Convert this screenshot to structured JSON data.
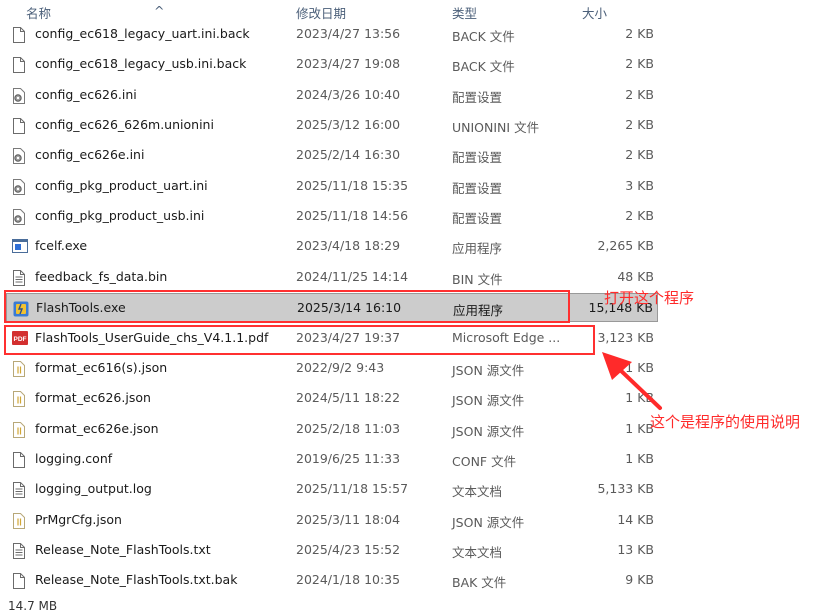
{
  "header": {
    "col_name": "名称",
    "col_date": "修改日期",
    "col_type": "类型",
    "col_size": "大小",
    "fragment": "^"
  },
  "files": [
    {
      "name": "config_ec618_legacy_uart.ini.back",
      "date": "2023/4/27 13:56",
      "type": "BACK 文件",
      "size": "2 KB",
      "icon": "blank-file-icon"
    },
    {
      "name": "config_ec618_legacy_usb.ini.back",
      "date": "2023/4/27 19:08",
      "type": "BACK 文件",
      "size": "2 KB",
      "icon": "blank-file-icon"
    },
    {
      "name": "config_ec626.ini",
      "date": "2024/3/26 10:40",
      "type": "配置设置",
      "size": "2 KB",
      "icon": "settings-file-icon"
    },
    {
      "name": "config_ec626_626m.unionini",
      "date": "2025/3/12 16:00",
      "type": "UNIONINI 文件",
      "size": "2 KB",
      "icon": "blank-file-icon"
    },
    {
      "name": "config_ec626e.ini",
      "date": "2025/2/14 16:30",
      "type": "配置设置",
      "size": "2 KB",
      "icon": "settings-file-icon"
    },
    {
      "name": "config_pkg_product_uart.ini",
      "date": "2025/11/18 15:35",
      "type": "配置设置",
      "size": "3 KB",
      "icon": "settings-file-icon"
    },
    {
      "name": "config_pkg_product_usb.ini",
      "date": "2025/11/18 14:56",
      "type": "配置设置",
      "size": "2 KB",
      "icon": "settings-file-icon"
    },
    {
      "name": "fcelf.exe",
      "date": "2023/4/18 18:29",
      "type": "应用程序",
      "size": "2,265 KB",
      "icon": "exe-icon"
    },
    {
      "name": "feedback_fs_data.bin",
      "date": "2024/11/25 14:14",
      "type": "BIN 文件",
      "size": "48 KB",
      "icon": "text-file-icon"
    },
    {
      "name": "FlashTools.exe",
      "date": "2025/3/14 16:10",
      "type": "应用程序",
      "size": "15,148 KB",
      "icon": "flashtools-app-icon",
      "selected": true
    },
    {
      "name": "FlashTools_UserGuide_chs_V4.1.1.pdf",
      "date": "2023/4/27 19:37",
      "type": "Microsoft Edge ...",
      "size": "3,123 KB",
      "icon": "pdf-icon"
    },
    {
      "name": "format_ec616(s).json",
      "date": "2022/9/2 9:43",
      "type": "JSON 源文件",
      "size": "1 KB",
      "icon": "json-file-icon"
    },
    {
      "name": "format_ec626.json",
      "date": "2024/5/11 18:22",
      "type": "JSON 源文件",
      "size": "1 KB",
      "icon": "json-file-icon"
    },
    {
      "name": "format_ec626e.json",
      "date": "2025/2/18 11:03",
      "type": "JSON 源文件",
      "size": "1 KB",
      "icon": "json-file-icon"
    },
    {
      "name": "logging.conf",
      "date": "2019/6/25 11:33",
      "type": "CONF 文件",
      "size": "1 KB",
      "icon": "blank-file-icon"
    },
    {
      "name": "logging_output.log",
      "date": "2025/11/18 15:57",
      "type": "文本文档",
      "size": "5,133 KB",
      "icon": "text-file-icon"
    },
    {
      "name": "PrMgrCfg.json",
      "date": "2025/3/11 18:04",
      "type": "JSON 源文件",
      "size": "14 KB",
      "icon": "json-file-icon"
    },
    {
      "name": "Release_Note_FlashTools.txt",
      "date": "2025/4/23 15:52",
      "type": "文本文档",
      "size": "13 KB",
      "icon": "text-file-icon"
    },
    {
      "name": "Release_Note_FlashTools.txt.bak",
      "date": "2024/1/18 10:35",
      "type": "BAK 文件",
      "size": "9 KB",
      "icon": "blank-file-icon"
    }
  ],
  "annotations": {
    "open_program": "打开这个程序",
    "usage_guide": "这个是程序的使用说明"
  },
  "status": {
    "size_text": "14.7 MB"
  },
  "colors": {
    "annotation_red": "#ff2a2a",
    "selection_bg": "#cccccc",
    "header_text": "#4c607a"
  }
}
